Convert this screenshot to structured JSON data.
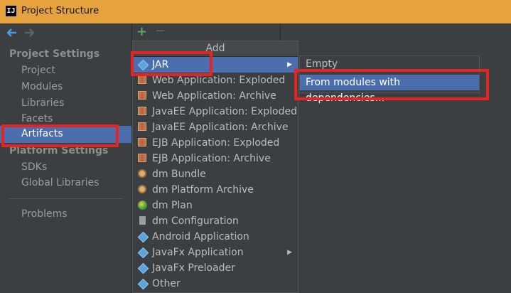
{
  "window": {
    "title": "Project Structure",
    "app_logo_text": "IJ"
  },
  "sidebar": {
    "project_settings_header": "Project Settings",
    "project_items": [
      "Project",
      "Modules",
      "Libraries",
      "Facets",
      "Artifacts"
    ],
    "selected_item": "Artifacts",
    "platform_settings_header": "Platform Settings",
    "platform_items": [
      "SDKs",
      "Global Libraries"
    ],
    "problems_label": "Problems"
  },
  "add_menu": {
    "header": "Add",
    "items": [
      {
        "label": "JAR",
        "icon": "jar-icon",
        "submenu": true,
        "highlighted": true
      },
      {
        "label": "Web Application: Exploded",
        "icon": "web-app-icon"
      },
      {
        "label": "Web Application: Archive",
        "icon": "web-app-icon"
      },
      {
        "label": "JavaEE Application: Exploded",
        "icon": "javaee-icon"
      },
      {
        "label": "JavaEE Application: Archive",
        "icon": "javaee-icon"
      },
      {
        "label": "EJB Application: Exploded",
        "icon": "ejb-icon"
      },
      {
        "label": "EJB Application: Archive",
        "icon": "ejb-icon"
      },
      {
        "label": "dm Bundle",
        "icon": "dm-bundle-icon"
      },
      {
        "label": "dm Platform Archive",
        "icon": "dm-platform-icon"
      },
      {
        "label": "dm Plan",
        "icon": "dm-plan-icon"
      },
      {
        "label": "dm Configuration",
        "icon": "dm-config-icon"
      },
      {
        "label": "Android Application",
        "icon": "android-icon"
      },
      {
        "label": "JavaFx Application",
        "icon": "javafx-icon",
        "submenu": true
      },
      {
        "label": "JavaFx Preloader",
        "icon": "javafx-icon"
      },
      {
        "label": "Other",
        "icon": "other-icon"
      }
    ]
  },
  "jar_submenu": {
    "items": [
      "Empty",
      "From modules with dependencies..."
    ],
    "highlighted": "From modules with dependencies..."
  },
  "colors": {
    "selection": "#4b6eaf",
    "title_bar": "#e6a23c",
    "highlight_box": "#e52323"
  }
}
